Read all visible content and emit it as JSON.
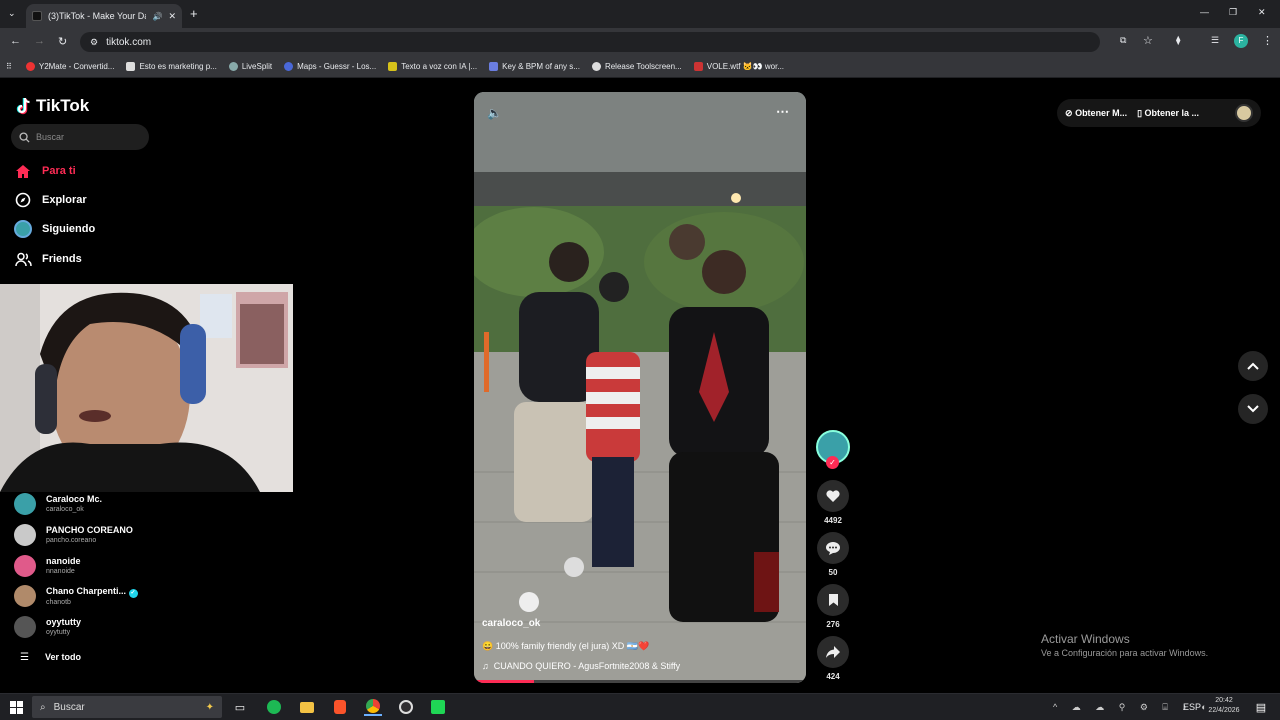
{
  "browser": {
    "tab_title": "(3)TikTok - Make Your Day",
    "new_tab": "+",
    "url": "tiktok.com",
    "window_buttons": [
      "—",
      "❐",
      "✕"
    ],
    "bookmarks": [
      {
        "label": "Y2Mate - Convertid...",
        "color": "#e33"
      },
      {
        "label": "Esto es marketing p...",
        "color": "#ddd"
      },
      {
        "label": "LiveSplit",
        "color": "#8aa"
      },
      {
        "label": "Maps - Guessr - Los...",
        "color": "#4a68d8"
      },
      {
        "label": "Texto a voz con IA |...",
        "color": "#d6c21a"
      },
      {
        "label": "Key & BPM of any s...",
        "color": "#6a7de0"
      },
      {
        "label": "Release Toolscreen...",
        "color": "#ddd"
      },
      {
        "label": "VOLE.wtf 🐱👀 wor...",
        "color": "#c33"
      }
    ],
    "profile_initial": "F"
  },
  "sidebar": {
    "logo": "TikTok",
    "search_placeholder": "Buscar",
    "nav": [
      {
        "label": "Para ti",
        "icon": "home-icon",
        "active": true
      },
      {
        "label": "Explorar",
        "icon": "compass-icon"
      },
      {
        "label": "Siguiendo",
        "icon": "following-avatar"
      },
      {
        "label": "Friends",
        "icon": "friends-icon"
      }
    ],
    "following": [
      {
        "name": "Caraloco Mc.",
        "handle": "caraloco_ok",
        "color": "#3aa0a8",
        "verified": false
      },
      {
        "name": "PANCHO COREANO",
        "handle": "pancho.coreano",
        "color": "#c9c9c9",
        "verified": false
      },
      {
        "name": "nanoide",
        "handle": "nnanoide",
        "color": "#e05a8a",
        "verified": false
      },
      {
        "name": "Chano Charpenti...",
        "handle": "chanotb",
        "color": "#b08a6a",
        "verified": true
      },
      {
        "name": "oyytutty",
        "handle": "oyytutty",
        "color": "#555",
        "verified": false
      }
    ],
    "see_all": "Ver todo"
  },
  "top_buttons": {
    "get_coins": "Obtener M...",
    "get_app": "Obtener la ..."
  },
  "video": {
    "author": "caraloco_ok",
    "description": "😀 100% family friendly (el jura) XD 🇦🇷❤️",
    "music": "CUANDO QUIERO - AgusFortnite2008 & Stiffy",
    "likes": "4492",
    "comments": "50",
    "saves": "276",
    "shares": "424",
    "progress": 0.18
  },
  "watermark": {
    "title": "Activar Windows",
    "subtitle": "Ve a Configuración para activar Windows."
  },
  "taskbar": {
    "search": "Buscar",
    "language": "ESP",
    "time": "20:42",
    "date": "22/4/2026"
  }
}
